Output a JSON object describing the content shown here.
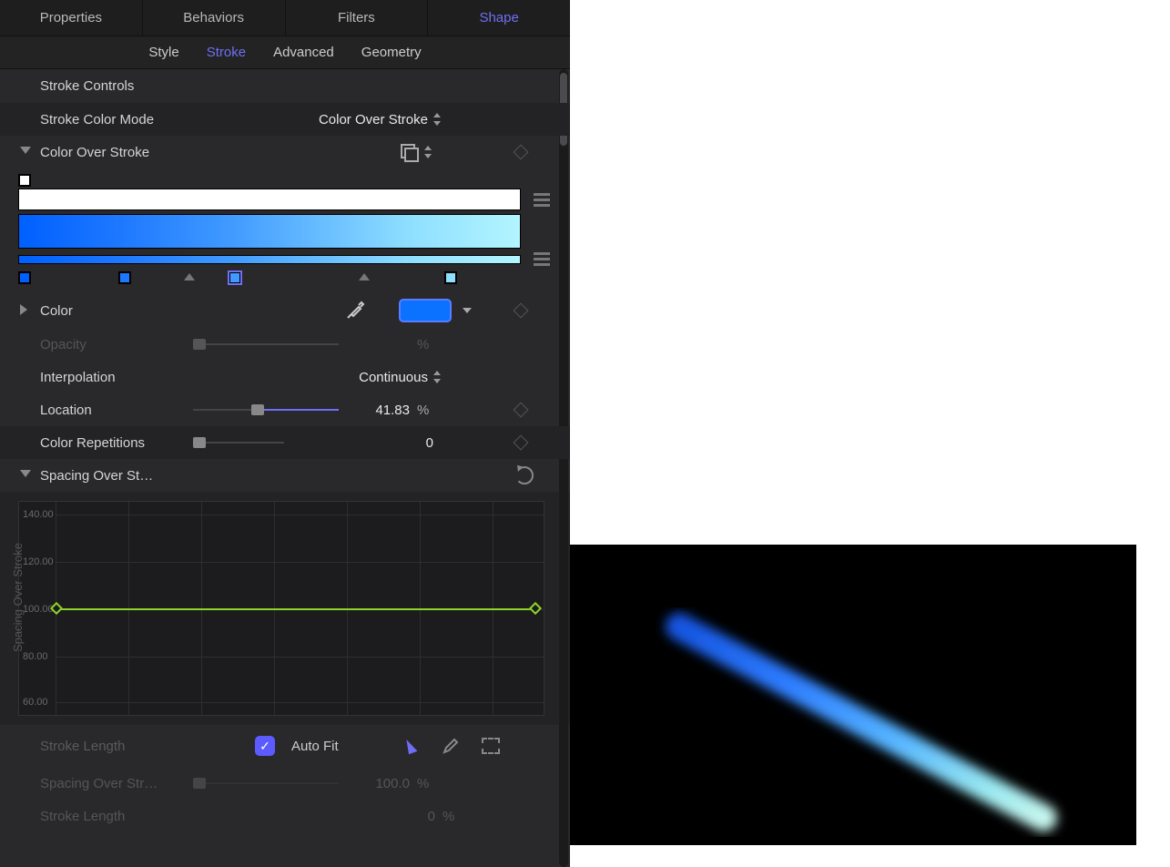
{
  "tabs": {
    "properties": "Properties",
    "behaviors": "Behaviors",
    "filters": "Filters",
    "shape": "Shape"
  },
  "subtabs": {
    "style": "Style",
    "stroke": "Stroke",
    "advanced": "Advanced",
    "geometry": "Geometry"
  },
  "sections": {
    "stroke_controls": "Stroke Controls"
  },
  "params": {
    "stroke_color_mode": {
      "label": "Stroke Color Mode",
      "value": "Color Over Stroke"
    },
    "color_over_stroke": {
      "label": "Color Over Stroke"
    },
    "color": {
      "label": "Color",
      "swatch": "#0a72ff"
    },
    "opacity": {
      "label": "Opacity",
      "unit": "%"
    },
    "interpolation": {
      "label": "Interpolation",
      "value": "Continuous"
    },
    "location": {
      "label": "Location",
      "value": "41.83",
      "unit": "%"
    },
    "color_repetitions": {
      "label": "Color Repetitions",
      "value": "0"
    },
    "spacing_over_stroke": {
      "label": "Spacing Over St…"
    },
    "spacing_over_str": {
      "label": "Spacing Over Str…",
      "value": "100.0",
      "unit": "%"
    },
    "stroke_length_top": {
      "label": "Stroke Length"
    },
    "stroke_length": {
      "label": "Stroke Length",
      "value": "0",
      "unit": "%"
    },
    "auto_fit": {
      "label": "Auto Fit",
      "checked": true
    }
  },
  "gradient": {
    "stops": [
      {
        "position": 0,
        "color": "#0060ff"
      },
      {
        "position": 20,
        "color": "#1e78ff"
      },
      {
        "position": 42,
        "color": "#409aff",
        "selected": true
      },
      {
        "position": 85,
        "color": "#8edfff"
      }
    ],
    "midpoints": [
      33,
      68
    ]
  },
  "chart_data": {
    "type": "line",
    "title": "Spacing Over Stroke",
    "ylabel": "Spacing Over Stroke",
    "ylim": [
      50,
      150
    ],
    "yticks": [
      60,
      80,
      100,
      120,
      140
    ],
    "x": [
      0,
      100
    ],
    "series": [
      {
        "name": "Spacing",
        "values": [
          100,
          100
        ]
      }
    ]
  }
}
